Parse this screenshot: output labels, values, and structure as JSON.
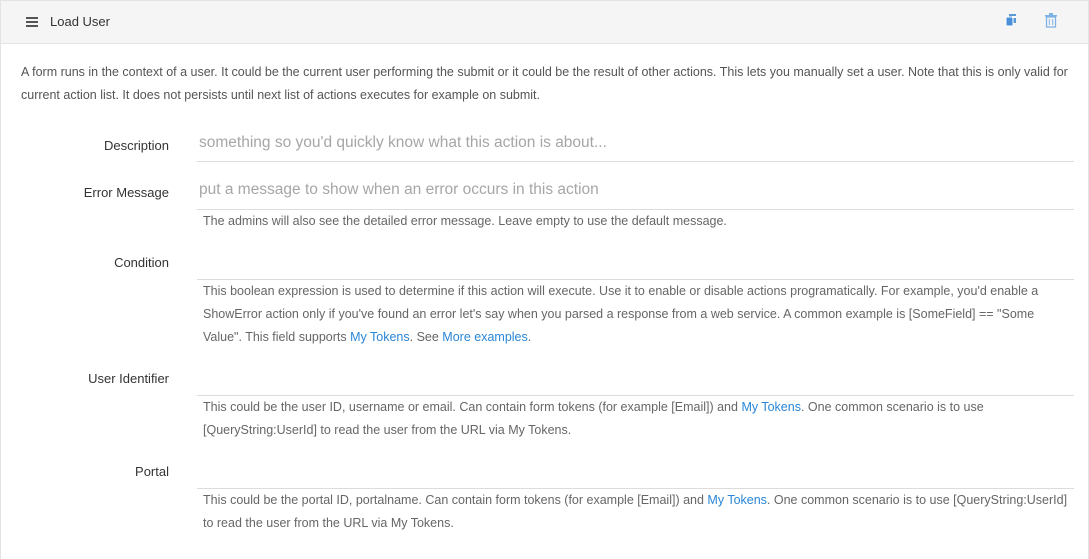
{
  "header": {
    "title": "Load User",
    "accent_color": "#4a90d9"
  },
  "intro_text": "A form runs in the context of a user. It could be the current user performing the submit or it could be the result of other actions. This lets you manually set a user. Note that this is only valid for current action list. It does not persists until next list of actions executes for example on submit.",
  "fields": {
    "description": {
      "label": "Description",
      "placeholder": "something so you'd quickly know what this action is about..."
    },
    "error_message": {
      "label": "Error Message",
      "placeholder": "put a message to show when an error occurs in this action",
      "help": "The admins will also see the detailed error message. Leave empty to use the default message."
    },
    "condition": {
      "label": "Condition",
      "help_part1": "This boolean expression is used to determine if this action will execute. Use it to enable or disable actions programatically. For example, you'd enable a ShowError action only if you've found an error let's say when you parsed a response from a web service. A common example is [SomeField] == \"Some Value\". This field supports ",
      "help_link1": "My Tokens",
      "help_part2": ". See ",
      "help_link2": "More examples",
      "help_part3": "."
    },
    "user_identifier": {
      "label": "User Identifier",
      "help_part1": "This could be the user ID, username or email. Can contain form tokens (for example [Email]) and ",
      "help_link1": "My Tokens",
      "help_part2": ". One common scenario is to use [QueryString:UserId] to read the user from the URL via My Tokens."
    },
    "portal": {
      "label": "Portal",
      "help_part1": "This could be the portal ID, portalname. Can contain form tokens (for example [Email]) and ",
      "help_link1": "My Tokens",
      "help_part2": ". One common scenario is to use [QueryString:UserId] to read the user from the URL via My Tokens."
    }
  }
}
